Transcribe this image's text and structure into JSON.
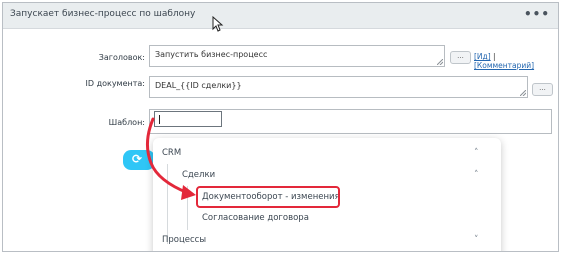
{
  "header": {
    "title": "Запускает бизнес-процесс по шаблону",
    "menu": "•••"
  },
  "form": {
    "title_label": "Заголовок:",
    "title_value": "Запустить бизнес-процесс",
    "title_button": "...",
    "link_id": "[Ид]",
    "link_comment": "[Комментарий]",
    "docid_label": "ID документа:",
    "docid_value": "DEAL_{{ID сделки}}",
    "docid_button": "...",
    "template_label": "Шаблон:",
    "template_value": ""
  },
  "action_button": {
    "icon": "refresh-icon",
    "glyph": "⟳"
  },
  "dropdown": {
    "items": [
      {
        "label": "CRM",
        "chevron": "˄"
      },
      {
        "label": "Сделки",
        "chevron": "˄"
      },
      {
        "label": "Документооборот - изменения"
      },
      {
        "label": "Согласование договора"
      },
      {
        "label": "Процессы",
        "chevron": "˅"
      }
    ]
  },
  "colors": {
    "highlight": "#e3283a",
    "accent": "#2fc6f6",
    "link": "#2467b0"
  }
}
